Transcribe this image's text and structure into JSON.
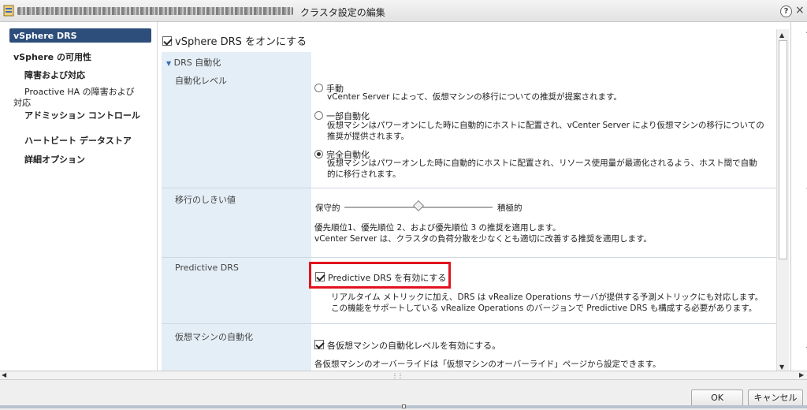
{
  "window": {
    "title": "クラスタ設定の編集",
    "help_label": "?",
    "close_label": "×"
  },
  "nav": {
    "items": [
      {
        "label": "vSphere DRS"
      },
      {
        "label": "vSphere の可用性"
      },
      {
        "label": "障害および対応"
      },
      {
        "label": "Proactive HA の障害および"
      },
      {
        "label": "対応"
      },
      {
        "label": "アドミッション コントロール"
      },
      {
        "label": "ハートビート データストア"
      },
      {
        "label": "詳細オプション"
      }
    ]
  },
  "content": {
    "enable_drs_label": "vSphere DRS をオンにする",
    "section_drs_automation": "DRS 自動化",
    "automation_level": {
      "label": "自動化レベル",
      "options": [
        {
          "label": "手動",
          "desc": "vCenter Server によって、仮想マシンの移行についての推奨が提案されます。"
        },
        {
          "label": "一部自動化",
          "desc_line1": "仮想マシンはパワーオンにした時に自動的にホストに配置され、vCenter Server により仮想マシンの移行についての",
          "desc_line2": "推奨が提供されます。"
        },
        {
          "label": "完全自動化",
          "desc_line1": "仮想マシンはパワーオンした時に自動的にホストに配置され、リソース使用量が最適化されるよう、ホスト間で自動",
          "desc_line2": "的に移行されます。"
        }
      ],
      "selected": "完全自動化"
    },
    "migration_threshold": {
      "label": "移行のしきい値",
      "left_label": "保守的",
      "right_label": "積極的",
      "value_fraction": 0.5,
      "desc_line1": "優先順位1、優先順位 2、および優先順位 3 の推奨を適用します。",
      "desc_line2": "vCenter Server は、クラスタの負荷分散を少なくとも適切に改善する推奨を適用します。"
    },
    "predictive_drs": {
      "label": "Predictive DRS",
      "checkbox_label": "Predictive DRS を有効にする",
      "desc_line1": "リアルタイム メトリックに加え、DRS は vRealize Operations サーバが提供する予測メトリックにも対応します。",
      "desc_line2": "この機能をサポートしている vRealize Operations のバージョンで Predictive DRS も構成する必要があります。"
    },
    "vm_automation": {
      "label": "仮想マシンの自動化",
      "checkbox_label": "各仮想マシンの自動化レベルを有効にする。",
      "desc": "各仮想マシンのオーバーライドは「仮想マシンのオーバーライド」ページから設定できます。"
    }
  },
  "footer": {
    "ok_label": "OK",
    "cancel_label": "キャンセル"
  },
  "colors": {
    "nav_active_bg": "#2d4e7a",
    "label_col_bg": "#e4eef7",
    "highlight": "#e2141e"
  }
}
